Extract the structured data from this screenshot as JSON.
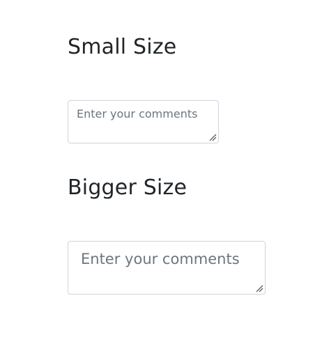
{
  "sections": [
    {
      "heading": "Small Size",
      "textarea": {
        "value": "",
        "placeholder": "Enter your comments"
      }
    },
    {
      "heading": "Bigger Size",
      "textarea": {
        "value": "",
        "placeholder": "Enter your comments"
      }
    }
  ],
  "colors": {
    "text": "#212529",
    "placeholder": "#6c757d",
    "border": "#ced4da",
    "background": "#ffffff"
  },
  "icons": {
    "resize_handle": "resize-grip-icon"
  }
}
